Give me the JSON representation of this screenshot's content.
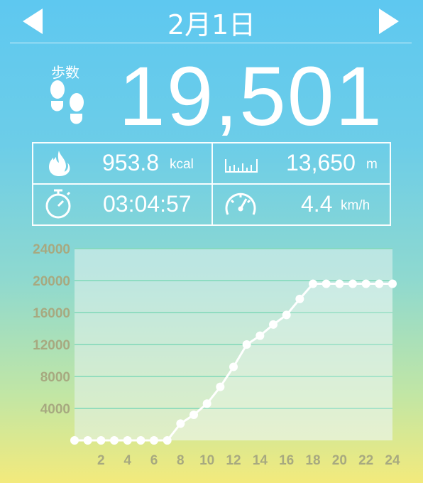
{
  "header": {
    "date": "2月1日",
    "prev_icon": "triangle-left-icon",
    "next_icon": "triangle-right-icon"
  },
  "steps": {
    "label": "歩数",
    "value": "19,501",
    "icon": "footprints-icon"
  },
  "stats": {
    "calories": {
      "value": "953.8",
      "unit": "kcal",
      "icon": "flame-icon"
    },
    "distance": {
      "value": "13,650",
      "unit": "m",
      "icon": "ruler-icon"
    },
    "time": {
      "value": "03:04:57",
      "icon": "stopwatch-icon"
    },
    "speed": {
      "value": "4.4",
      "unit": "km/h",
      "icon": "speedometer-icon"
    }
  },
  "colors": {
    "text": "#ffffff",
    "axis_label": "#a7a980",
    "plot_bg": "#e6f2ee",
    "grid": "#7fd8b8"
  },
  "chart_data": {
    "type": "line",
    "x": [
      0,
      1,
      2,
      3,
      4,
      5,
      6,
      7,
      8,
      9,
      10,
      11,
      12,
      13,
      14,
      15,
      16,
      17,
      18,
      19,
      20,
      21,
      22,
      23,
      24
    ],
    "y": [
      0,
      0,
      0,
      0,
      0,
      0,
      0,
      0,
      2100,
      3200,
      4600,
      6700,
      9200,
      12000,
      13100,
      14500,
      15700,
      17700,
      19600,
      19600,
      19600,
      19600,
      19600,
      19600,
      19600
    ],
    "xticks": [
      "2",
      "4",
      "6",
      "8",
      "10",
      "12",
      "14",
      "16",
      "18",
      "20",
      "22",
      "24"
    ],
    "yticks": [
      "4000",
      "8000",
      "12000",
      "16000",
      "20000",
      "24000"
    ],
    "xlim": [
      0,
      24
    ],
    "ylim": [
      0,
      24000
    ],
    "grid": true,
    "title": "",
    "xlabel": "",
    "ylabel": ""
  }
}
